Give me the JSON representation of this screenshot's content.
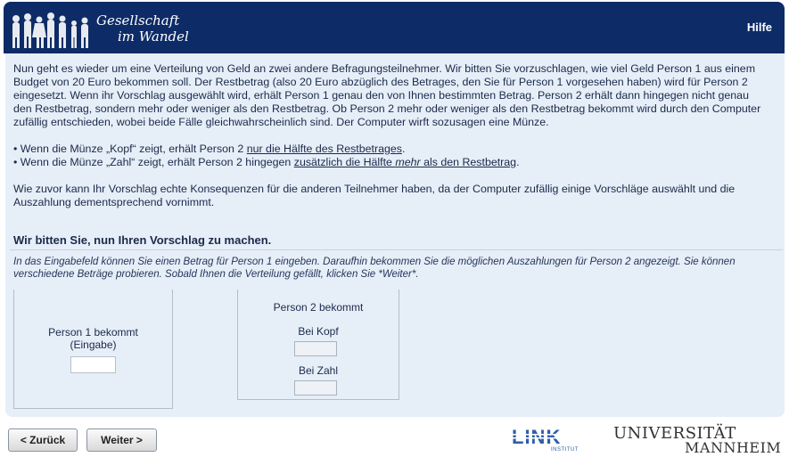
{
  "header": {
    "logo_line1": "Gesellschaft",
    "logo_line2": "im Wandel",
    "help_label": "Hilfe"
  },
  "intro": {
    "paragraph1": "Nun geht es wieder um eine Verteilung von Geld an zwei andere Befragungsteilnehmer. Wir bitten Sie vorzuschlagen, wie viel Geld Person 1 aus einem Budget von 20 Euro bekommen soll. Der Restbetrag (also 20 Euro abzüglich des Betrages, den Sie für Person 1 vorgesehen haben) wird für Person 2 eingesetzt. Wenn ihr Vorschlag ausgewählt wird, erhält Person 1 genau den von Ihnen bestimmten Betrag. Person 2 erhält dann hingegen nicht genau den Restbetrag, sondern mehr oder weniger als den Restbetrag. Ob Person 2 mehr oder weniger als den Restbetrag bekommt wird durch den Computer zufällig entschieden, wobei beide Fälle gleichwahrscheinlich sind. Der Computer wirft sozusagen eine Münze.",
    "bullet1_prefix": "• Wenn die Münze „Kopf“ zeigt, erhält Person 2 ",
    "bullet1_underlined": "nur die Hälfte des Restbetrages",
    "bullet1_suffix": ".",
    "bullet2_prefix": "• Wenn die Münze „Zahl“ zeigt, erhält Person 2 hingegen ",
    "bullet2_underlined_a": "zusätzlich die Hälfte ",
    "bullet2_underlined_italic": "mehr",
    "bullet2_underlined_b": " als den Restbetrag",
    "bullet2_suffix": ".",
    "paragraph2": "Wie zuvor kann Ihr Vorschlag echte Konsequenzen für die anderen Teilnehmer haben, da der Computer zufällig einige Vorschläge auswählt und die Auszahlung dementsprechend vornimmt."
  },
  "question": {
    "heading": "Wir bitten Sie, nun Ihren Vorschlag zu machen.",
    "instruction": "In das Eingabefeld können Sie einen Betrag für Person 1 eingeben. Daraufhin bekommen Sie die möglichen Auszahlungen für Person 2 angezeigt. Sie können verschiedene Beträge probieren. Sobald Ihnen die Verteilung gefällt, klicken Sie *Weiter*."
  },
  "person1": {
    "label_line1": "Person 1 bekommt",
    "label_line2": "(Eingabe)",
    "value": ""
  },
  "person2": {
    "label": "Person 2 bekommt",
    "kopf_label": "Bei Kopf",
    "kopf_value": "",
    "zahl_label": "Bei Zahl",
    "zahl_value": ""
  },
  "nav": {
    "back_label": "< Zurück",
    "next_label": "Weiter >"
  },
  "footer": {
    "link_logo_text": "LINK",
    "link_logo_sub": "INSTITUT",
    "uni_line1": "UNIVERSITÄT",
    "uni_line2": "MANNHEIM"
  },
  "colors": {
    "header_bg": "#0d2b66",
    "content_bg": "#e6eef8",
    "link_blue": "#2f5ea8"
  }
}
